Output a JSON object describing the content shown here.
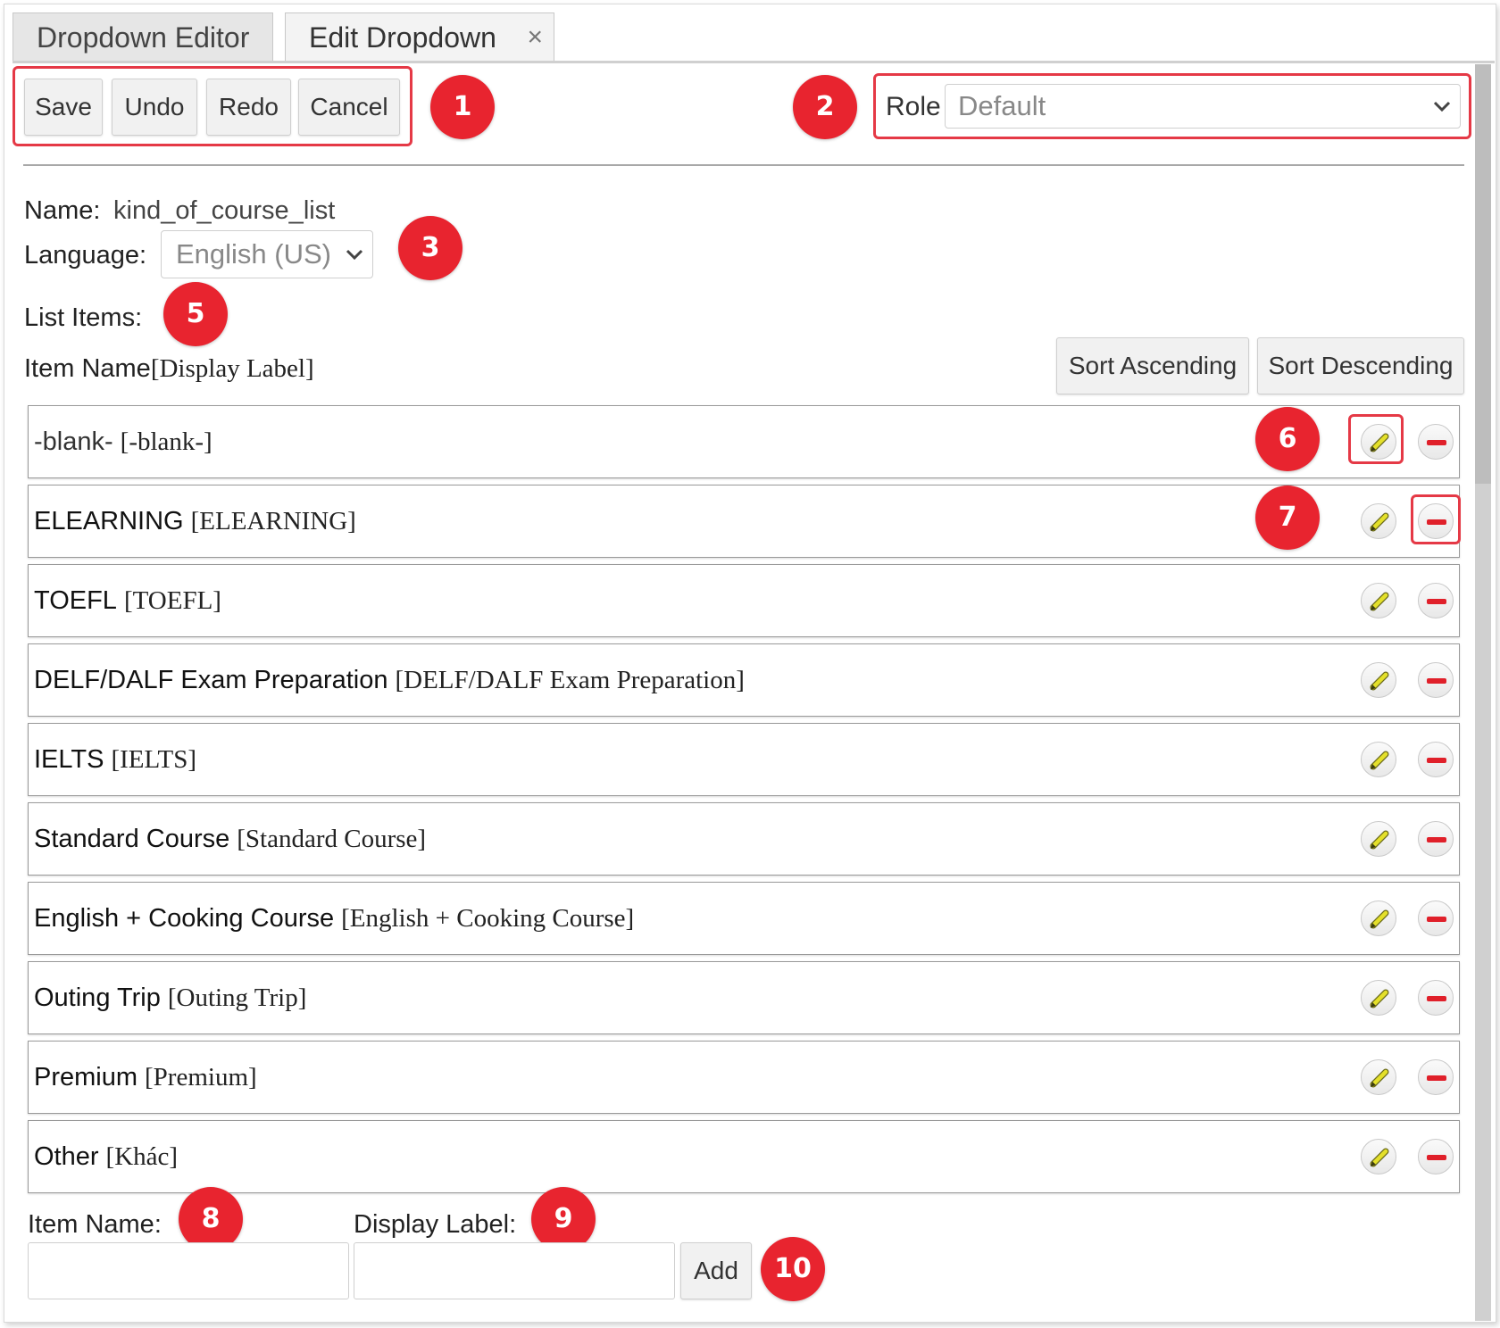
{
  "tabs": [
    {
      "label": "Dropdown Editor",
      "active": false
    },
    {
      "label": "Edit Dropdown",
      "active": true,
      "close_icon": "×"
    }
  ],
  "toolbar": {
    "save": "Save",
    "undo": "Undo",
    "redo": "Redo",
    "cancel": "Cancel"
  },
  "role": {
    "label": "Role",
    "value": "Default"
  },
  "form": {
    "name_label": "Name:",
    "name_value": "kind_of_course_list",
    "language_label": "Language:",
    "language_value": "English (US)",
    "list_items_label": "List Items:",
    "column_header_name": "Item Name",
    "column_header_display": "[Display Label]"
  },
  "sort": {
    "ascending": "Sort Ascending",
    "descending": "Sort Descending"
  },
  "items": [
    {
      "name": "-blank-",
      "display": "[-blank-]"
    },
    {
      "name": "ELEARNING",
      "display": "[ELEARNING]"
    },
    {
      "name": "TOEFL",
      "display": "[TOEFL]"
    },
    {
      "name": "DELF/DALF Exam Preparation",
      "display": "[DELF/DALF Exam Preparation]"
    },
    {
      "name": "IELTS",
      "display": "[IELTS]"
    },
    {
      "name": "Standard Course",
      "display": "[Standard Course]"
    },
    {
      "name": "English + Cooking Course",
      "display": "[English + Cooking Course]"
    },
    {
      "name": "Outing Trip",
      "display": "[Outing Trip]"
    },
    {
      "name": "Premium",
      "display": "[Premium]"
    },
    {
      "name": "Other",
      "display": "[Khác]"
    }
  ],
  "add_form": {
    "item_name_label": "Item Name:",
    "display_label_label": "Display Label:",
    "item_name_value": "",
    "display_label_value": "",
    "add_button": "Add"
  },
  "callouts": [
    "1",
    "2",
    "3",
    "5",
    "6",
    "7",
    "8",
    "9",
    "10"
  ],
  "icons": {
    "edit": "pencil-icon",
    "delete": "minus-circle-icon",
    "dropdown": "chevron-down-icon",
    "close": "close-icon"
  },
  "colors": {
    "callout": "#e8242f",
    "highlight": "#e53946",
    "pencil": "#e4e02a",
    "delete": "#e0202a"
  }
}
